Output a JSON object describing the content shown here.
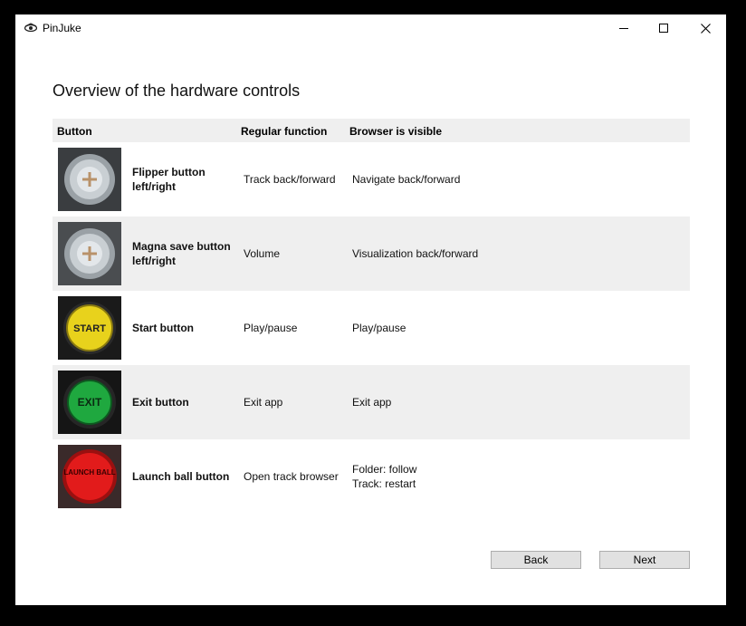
{
  "window": {
    "title": "PinJuke"
  },
  "page": {
    "heading": "Overview of the hardware controls"
  },
  "table": {
    "headers": {
      "button": "Button",
      "regular": "Regular function",
      "browser": "Browser is visible"
    },
    "rows": [
      {
        "name": "Flipper button left/right",
        "regular": "Track back/forward",
        "browser": [
          "Navigate back/forward"
        ],
        "icon": "flipper-button-photo",
        "color": "#9aa1a6"
      },
      {
        "name": "Magna save button left/right",
        "regular": "Volume",
        "browser": [
          "Visualization back/forward"
        ],
        "icon": "magna-save-button-photo",
        "color": "#9aa1a6"
      },
      {
        "name": "Start button",
        "regular": "Play/pause",
        "browser": [
          "Play/pause"
        ],
        "icon": "start-button-photo",
        "color": "#e8d21c",
        "label": "START"
      },
      {
        "name": "Exit button",
        "regular": "Exit app",
        "browser": [
          "Exit app"
        ],
        "icon": "exit-button-photo",
        "color": "#1fa83f",
        "label": "EXIT"
      },
      {
        "name": "Launch ball button",
        "regular": "Open track browser",
        "browser": [
          "Folder: follow",
          "Track: restart"
        ],
        "icon": "launch-ball-button-photo",
        "color": "#e21b1b",
        "label": "LAUNCH BALL"
      }
    ]
  },
  "footer": {
    "back_label": "Back",
    "next_label": "Next"
  }
}
